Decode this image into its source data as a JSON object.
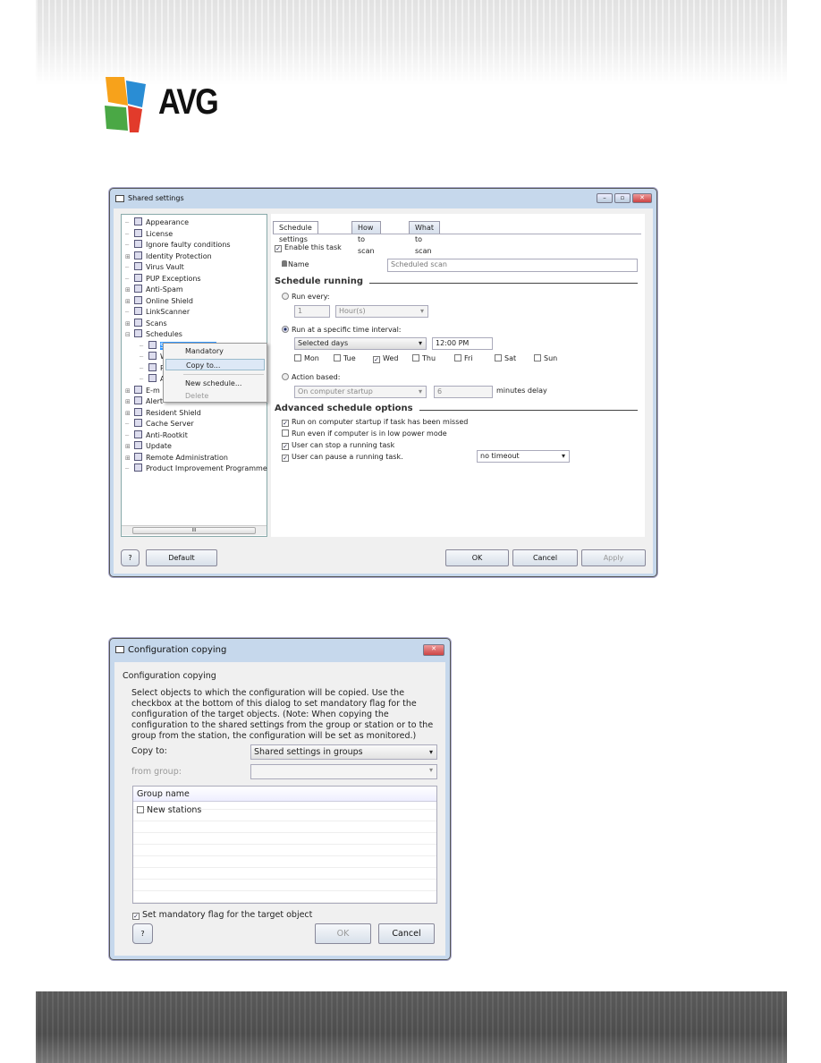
{
  "brand": {
    "logo_text": "AVG",
    "colors": [
      "#f7a21b",
      "#2a8dd4",
      "#4aa845",
      "#e23b2b"
    ]
  },
  "shared_settings": {
    "title": "Shared settings",
    "window_buttons": [
      "minimize",
      "maximize",
      "close"
    ],
    "tree": [
      {
        "label": "Appearance",
        "exp": false
      },
      {
        "label": "License",
        "exp": false
      },
      {
        "label": "Ignore faulty conditions",
        "exp": false
      },
      {
        "label": "Identity Protection",
        "exp": true
      },
      {
        "label": "Virus Vault",
        "exp": false
      },
      {
        "label": "PUP Exceptions",
        "exp": false
      },
      {
        "label": "Anti-Spam",
        "exp": true
      },
      {
        "label": "Online Shield",
        "exp": true
      },
      {
        "label": "LinkScanner",
        "exp": false
      },
      {
        "label": "Scans",
        "exp": true
      },
      {
        "label": "Schedules",
        "exp": true,
        "open": true
      },
      {
        "label": "Scheduled scan",
        "child": true,
        "selected": true
      },
      {
        "label": "W",
        "child": true
      },
      {
        "label": "P",
        "child": true
      },
      {
        "label": "A",
        "child": true
      },
      {
        "label": "E-m",
        "exp": true
      },
      {
        "label": "Alert",
        "exp": true
      },
      {
        "label": "Resident Shield",
        "exp": true
      },
      {
        "label": "Cache Server",
        "exp": false
      },
      {
        "label": "Anti-Rootkit",
        "exp": false
      },
      {
        "label": "Update",
        "exp": true
      },
      {
        "label": "Remote Administration",
        "exp": true
      },
      {
        "label": "Product Improvement Programme",
        "exp": false
      }
    ],
    "context_menu": {
      "items": [
        "Mandatory",
        "Copy to...",
        "New schedule...",
        "Delete"
      ],
      "highlighted": "Copy to...",
      "disabled": "Delete"
    },
    "tabs": [
      "Schedule settings",
      "How to scan",
      "What to scan"
    ],
    "active_tab": "Schedule settings",
    "enable_task": {
      "label": "Enable this task",
      "checked": true
    },
    "name": {
      "label": "Name",
      "value": "Scheduled scan"
    },
    "schedule_running": {
      "heading": "Schedule running",
      "run_every": {
        "label": "Run every:",
        "value": "1",
        "unit": "Hour(s)",
        "selected": false
      },
      "specific": {
        "label": "Run at a specific time interval:",
        "mode": "Selected days",
        "time": "12:00 PM",
        "selected": true,
        "days": [
          {
            "label": "Mon",
            "checked": false
          },
          {
            "label": "Tue",
            "checked": false
          },
          {
            "label": "Wed",
            "checked": true
          },
          {
            "label": "Thu",
            "checked": false
          },
          {
            "label": "Fri",
            "checked": false
          },
          {
            "label": "Sat",
            "checked": false
          },
          {
            "label": "Sun",
            "checked": false
          }
        ]
      },
      "action": {
        "label": "Action based:",
        "event": "On computer startup",
        "delay": "6",
        "delay_label": "minutes delay",
        "selected": false
      }
    },
    "advanced": {
      "heading": "Advanced schedule options",
      "options": [
        {
          "label": "Run on computer startup if task has been missed",
          "checked": true
        },
        {
          "label": "Run even if computer is in low power mode",
          "checked": false
        },
        {
          "label": "User can stop a running task",
          "checked": true
        },
        {
          "label": "User can pause a running task.",
          "checked": true
        }
      ],
      "pause_timeout": "no timeout"
    },
    "buttons": {
      "help": "?",
      "default": "Default",
      "ok": "OK",
      "cancel": "Cancel",
      "apply": "Apply"
    }
  },
  "config_copy": {
    "title": "Configuration copying",
    "heading": "Configuration copying",
    "description": "Select objects to which the configuration will be copied. Use the checkbox at the bottom of this dialog to set mandatory flag for the configuration of the target objects. (Note: When copying the configuration to the shared settings from the group or station or to the group from the station, the configuration will be set as monitored.)",
    "copy_to": {
      "label": "Copy to:",
      "value": "Shared settings in groups"
    },
    "from_group": {
      "label": "from group:",
      "value": ""
    },
    "table": {
      "header": "Group name",
      "rows": [
        {
          "label": "New stations",
          "checked": false
        }
      ]
    },
    "mandatory": {
      "label": "Set mandatory flag for the target object",
      "checked": true
    },
    "buttons": {
      "help": "?",
      "ok": "OK",
      "cancel": "Cancel"
    }
  }
}
